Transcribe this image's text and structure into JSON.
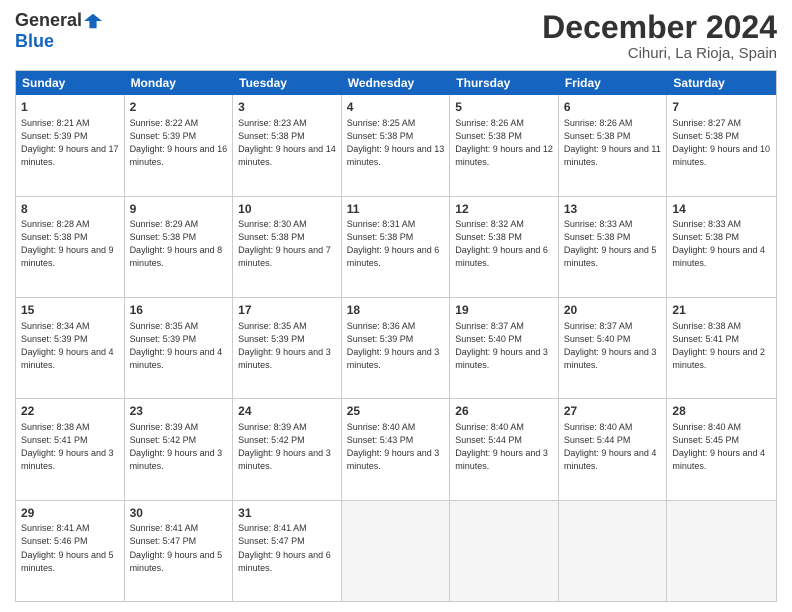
{
  "header": {
    "logo_general": "General",
    "logo_blue": "Blue",
    "month": "December 2024",
    "location": "Cihuri, La Rioja, Spain"
  },
  "weekdays": [
    "Sunday",
    "Monday",
    "Tuesday",
    "Wednesday",
    "Thursday",
    "Friday",
    "Saturday"
  ],
  "weeks": [
    [
      {
        "day": "1",
        "rise": "8:21 AM",
        "set": "5:39 PM",
        "daylight": "9 hours and 17 minutes."
      },
      {
        "day": "2",
        "rise": "8:22 AM",
        "set": "5:39 PM",
        "daylight": "9 hours and 16 minutes."
      },
      {
        "day": "3",
        "rise": "8:23 AM",
        "set": "5:38 PM",
        "daylight": "9 hours and 14 minutes."
      },
      {
        "day": "4",
        "rise": "8:25 AM",
        "set": "5:38 PM",
        "daylight": "9 hours and 13 minutes."
      },
      {
        "day": "5",
        "rise": "8:26 AM",
        "set": "5:38 PM",
        "daylight": "9 hours and 12 minutes."
      },
      {
        "day": "6",
        "rise": "8:26 AM",
        "set": "5:38 PM",
        "daylight": "9 hours and 11 minutes."
      },
      {
        "day": "7",
        "rise": "8:27 AM",
        "set": "5:38 PM",
        "daylight": "9 hours and 10 minutes."
      }
    ],
    [
      {
        "day": "8",
        "rise": "8:28 AM",
        "set": "5:38 PM",
        "daylight": "9 hours and 9 minutes."
      },
      {
        "day": "9",
        "rise": "8:29 AM",
        "set": "5:38 PM",
        "daylight": "9 hours and 8 minutes."
      },
      {
        "day": "10",
        "rise": "8:30 AM",
        "set": "5:38 PM",
        "daylight": "9 hours and 7 minutes."
      },
      {
        "day": "11",
        "rise": "8:31 AM",
        "set": "5:38 PM",
        "daylight": "9 hours and 6 minutes."
      },
      {
        "day": "12",
        "rise": "8:32 AM",
        "set": "5:38 PM",
        "daylight": "9 hours and 6 minutes."
      },
      {
        "day": "13",
        "rise": "8:33 AM",
        "set": "5:38 PM",
        "daylight": "9 hours and 5 minutes."
      },
      {
        "day": "14",
        "rise": "8:33 AM",
        "set": "5:38 PM",
        "daylight": "9 hours and 4 minutes."
      }
    ],
    [
      {
        "day": "15",
        "rise": "8:34 AM",
        "set": "5:39 PM",
        "daylight": "9 hours and 4 minutes."
      },
      {
        "day": "16",
        "rise": "8:35 AM",
        "set": "5:39 PM",
        "daylight": "9 hours and 4 minutes."
      },
      {
        "day": "17",
        "rise": "8:35 AM",
        "set": "5:39 PM",
        "daylight": "9 hours and 3 minutes."
      },
      {
        "day": "18",
        "rise": "8:36 AM",
        "set": "5:39 PM",
        "daylight": "9 hours and 3 minutes."
      },
      {
        "day": "19",
        "rise": "8:37 AM",
        "set": "5:40 PM",
        "daylight": "9 hours and 3 minutes."
      },
      {
        "day": "20",
        "rise": "8:37 AM",
        "set": "5:40 PM",
        "daylight": "9 hours and 3 minutes."
      },
      {
        "day": "21",
        "rise": "8:38 AM",
        "set": "5:41 PM",
        "daylight": "9 hours and 2 minutes."
      }
    ],
    [
      {
        "day": "22",
        "rise": "8:38 AM",
        "set": "5:41 PM",
        "daylight": "9 hours and 3 minutes."
      },
      {
        "day": "23",
        "rise": "8:39 AM",
        "set": "5:42 PM",
        "daylight": "9 hours and 3 minutes."
      },
      {
        "day": "24",
        "rise": "8:39 AM",
        "set": "5:42 PM",
        "daylight": "9 hours and 3 minutes."
      },
      {
        "day": "25",
        "rise": "8:40 AM",
        "set": "5:43 PM",
        "daylight": "9 hours and 3 minutes."
      },
      {
        "day": "26",
        "rise": "8:40 AM",
        "set": "5:44 PM",
        "daylight": "9 hours and 3 minutes."
      },
      {
        "day": "27",
        "rise": "8:40 AM",
        "set": "5:44 PM",
        "daylight": "9 hours and 4 minutes."
      },
      {
        "day": "28",
        "rise": "8:40 AM",
        "set": "5:45 PM",
        "daylight": "9 hours and 4 minutes."
      }
    ],
    [
      {
        "day": "29",
        "rise": "8:41 AM",
        "set": "5:46 PM",
        "daylight": "9 hours and 5 minutes."
      },
      {
        "day": "30",
        "rise": "8:41 AM",
        "set": "5:47 PM",
        "daylight": "9 hours and 5 minutes."
      },
      {
        "day": "31",
        "rise": "8:41 AM",
        "set": "5:47 PM",
        "daylight": "9 hours and 6 minutes."
      },
      null,
      null,
      null,
      null
    ]
  ],
  "labels": {
    "sunrise": "Sunrise:",
    "sunset": "Sunset:",
    "daylight": "Daylight:"
  }
}
